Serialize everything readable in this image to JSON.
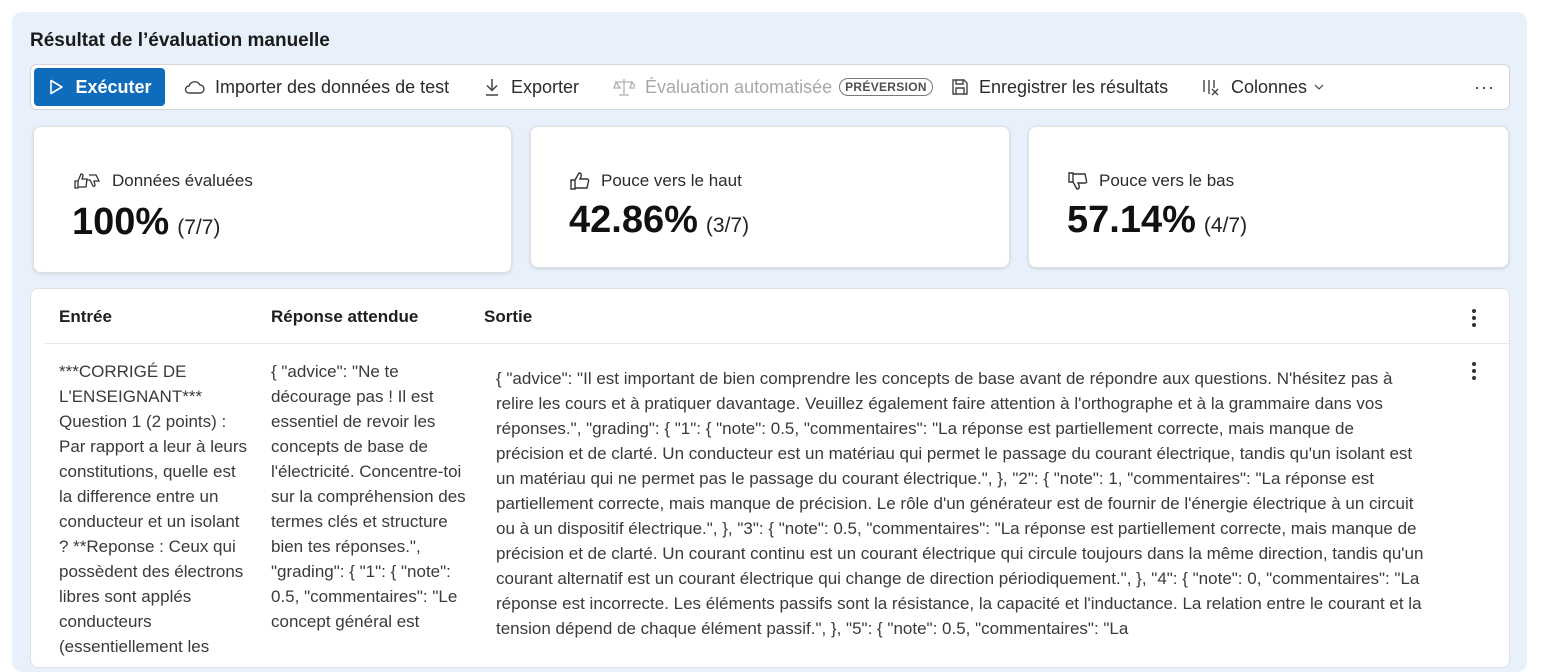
{
  "panel": {
    "title": "Résultat de l’évaluation manuelle"
  },
  "toolbar": {
    "run": {
      "label": "Exécuter",
      "icon": "play-icon"
    },
    "import": {
      "label": "Importer des données de test",
      "icon": "cloud-icon"
    },
    "export": {
      "label": "Exporter",
      "icon": "download-icon"
    },
    "auto_eval": {
      "label": "Évaluation automatisée",
      "badge": "PRÉVERSION",
      "icon": "scale-icon",
      "disabled": true
    },
    "save": {
      "label": "Enregistrer les résultats",
      "icon": "save-icon"
    },
    "columns": {
      "label": "Colonnes",
      "icon": "columns-icon"
    },
    "more": "···",
    "accent_color": "#0f6cbd"
  },
  "metrics": {
    "evaluated": {
      "label": "Données évaluées",
      "value": "100%",
      "fraction": "(7/7)",
      "icon": "thumbs-up-down-icon"
    },
    "thumbs_up": {
      "label": "Pouce vers le haut",
      "value": "42.86%",
      "fraction": "(3/7)",
      "icon": "thumbs-up-icon"
    },
    "thumbs_down": {
      "label": "Pouce vers le bas",
      "value": "57.14%",
      "fraction": "(4/7)",
      "icon": "thumbs-down-icon"
    }
  },
  "table": {
    "columns": [
      "Entrée",
      "Réponse attendue",
      "Sortie"
    ],
    "rows": [
      {
        "input": "***CORRIGÉ DE L'ENSEIGNANT*** Question 1 (2 points) : Par rapport a leur à leurs constitutions, quelle est la difference entre un conducteur et un isolant ? **Reponse : Ceux qui possèdent des électrons libres sont applés conducteurs (essentiellement les",
        "expected": "{ \"advice\": \"Ne te décourage pas ! Il est essentiel de revoir les concepts de base de l'électricité. Concentre-toi sur la compréhension des termes clés et structure bien tes réponses.\", \"grading\": { \"1\": { \"note\": 0.5, \"commentaires\": \"Le concept général est",
        "output": "{ \"advice\": \"Il est important de bien comprendre les concepts de base avant de répondre aux questions. N'hésitez pas à relire les cours et à pratiquer davantage. Veuillez également faire attention à l'orthographe et à la grammaire dans vos réponses.\", \"grading\": { \"1\": { \"note\": 0.5, \"commentaires\": \"La réponse est partiellement correcte, mais manque de précision et de clarté. Un conducteur est un matériau qui permet le passage du courant électrique, tandis qu'un isolant est un matériau qui ne permet pas le passage du courant électrique.\", }, \"2\": { \"note\": 1, \"commentaires\": \"La réponse est partiellement correcte, mais manque de précision. Le rôle d'un générateur est de fournir de l'énergie électrique à un circuit ou à un dispositif électrique.\", }, \"3\": { \"note\": 0.5, \"commentaires\": \"La réponse est partiellement correcte, mais manque de précision et de clarté. Un courant continu est un courant électrique qui circule toujours dans la même direction, tandis qu'un courant alternatif est un courant électrique qui change de direction périodiquement.\", }, \"4\": { \"note\": 0, \"commentaires\": \"La réponse est incorrecte. Les éléments passifs sont la résistance, la capacité et l'inductance. La relation entre le courant et la tension dépend de chaque élément passif.\", }, \"5\": { \"note\": 0.5, \"commentaires\": \"La"
      }
    ]
  }
}
